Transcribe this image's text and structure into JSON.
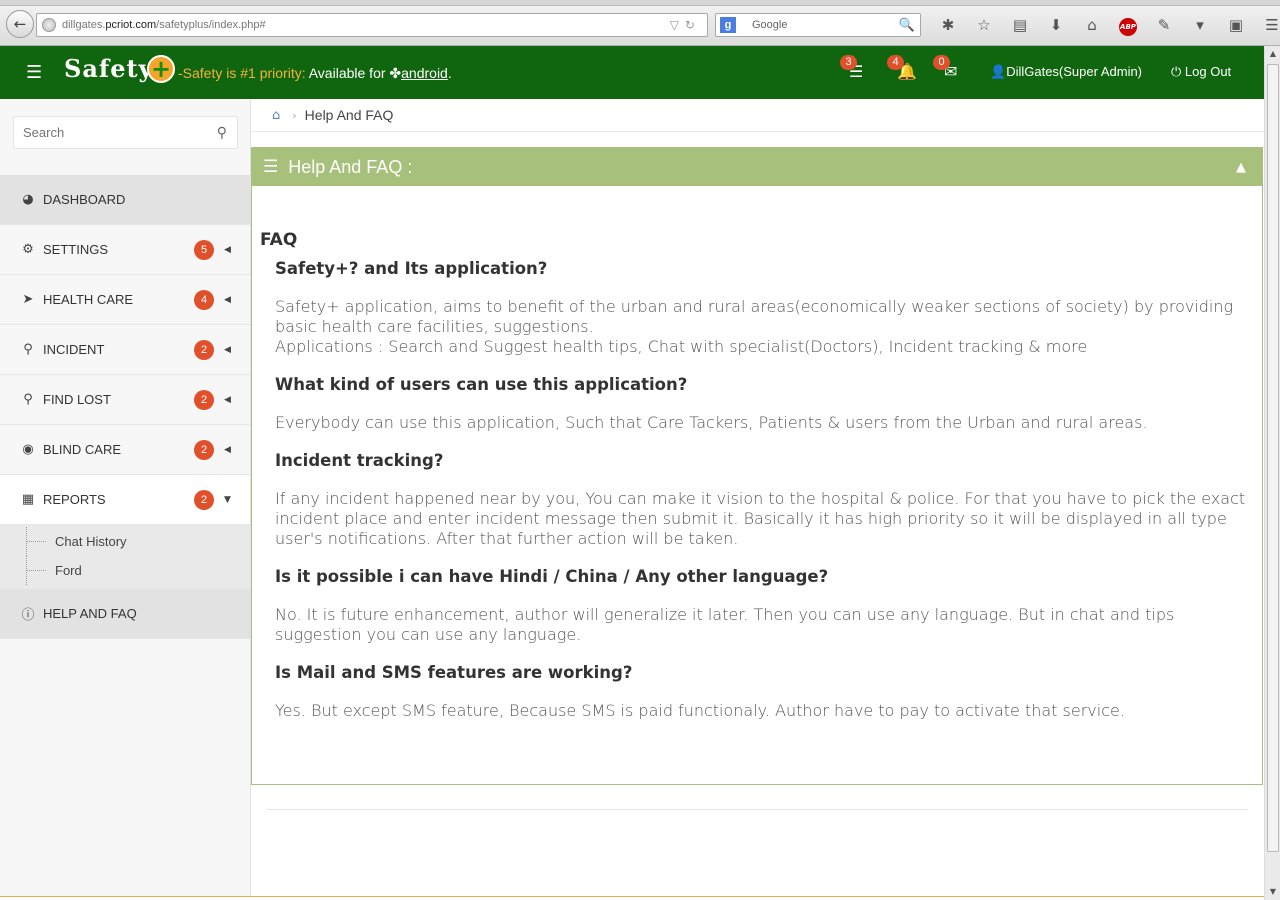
{
  "browser": {
    "url_host": "dillgates.",
    "url_domain": "pcriot.com",
    "url_path": "/safetyplus/index.php#",
    "search_placeholder": "Google",
    "search_engine_icon": "g",
    "abp_label": "ABP"
  },
  "header": {
    "logo_text": "Safety",
    "logo_plus": "+",
    "tagline_orange": "-Safety is #1 priority:",
    "tagline_white": " Available for ",
    "android_link": "android",
    "tagline_end": ".",
    "notifications": [
      {
        "icon": "messages-icon",
        "count": "3"
      },
      {
        "icon": "bell-icon",
        "count": "4"
      },
      {
        "icon": "envelope-icon",
        "count": "0"
      }
    ],
    "user": "DillGates(Super Admin)",
    "logout": "Log Out"
  },
  "sidebar": {
    "search_placeholder": "Search",
    "items": [
      {
        "label": "DASHBOARD",
        "icon": "dashboard-icon",
        "badge": "",
        "caret": ""
      },
      {
        "label": "SETTINGS",
        "icon": "gears-icon",
        "badge": "5",
        "caret": "◀"
      },
      {
        "label": "HEALTH CARE",
        "icon": "location-arrow-icon",
        "badge": "4",
        "caret": "◀"
      },
      {
        "label": "INCIDENT",
        "icon": "map-marker-icon",
        "badge": "2",
        "caret": "◀"
      },
      {
        "label": "FIND LOST",
        "icon": "map-marker-icon",
        "badge": "2",
        "caret": "◀"
      },
      {
        "label": "BLIND CARE",
        "icon": "eye-slash-icon",
        "badge": "2",
        "caret": "◀"
      },
      {
        "label": "REPORTS",
        "icon": "table-icon",
        "badge": "2",
        "caret": "▼"
      }
    ],
    "report_subitems": [
      "Chat History",
      "Ford"
    ],
    "help": {
      "label": "HELP AND FAQ",
      "icon": "info-circle-icon"
    }
  },
  "breadcrumb": {
    "current": "Help And FAQ"
  },
  "panel": {
    "title": "Help And FAQ :",
    "faq_heading": "FAQ",
    "faqs": [
      {
        "q": "Safety+? and Its application?",
        "a": "Safety+ application, aims to benefit of the urban and rural areas(economically weaker sections of society) by providing basic health care facilities, suggestions.\nApplications : Search and Suggest health tips, Chat with specialist(Doctors), Incident tracking & more"
      },
      {
        "q": "What kind of users can use this application?",
        "a": "Everybody can use this application, Such that Care Tackers, Patients & users from the Urban and rural areas."
      },
      {
        "q": "Incident tracking?",
        "a": "If any incident happened near by you, You can make it vision to the hospital & police. For that you have to pick the exact incident place and enter incident message then submit it. Basically it has high priority so it will be displayed in all type user's notifications. After that further action will be taken."
      },
      {
        "q": "Is it possible i can have Hindi / China / Any other language?",
        "a": "No. It is future enhancement, author will generalize it later. Then you can use any language. But in chat and tips suggestion you can use any language."
      },
      {
        "q": "Is Mail and SMS features are working?",
        "a": "Yes. But except SMS feature, Because SMS is paid functionaly. Author have to pay to activate that service."
      }
    ]
  }
}
